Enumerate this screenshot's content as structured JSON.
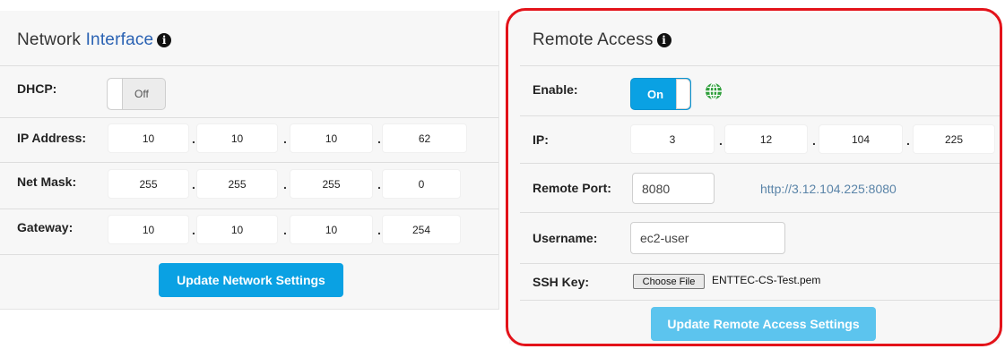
{
  "network": {
    "title_part1": "Network",
    "title_part2": "Interface",
    "dhcp_label": "DHCP:",
    "dhcp_state": "Off",
    "ip_label": "IP Address:",
    "ip": [
      "10",
      "10",
      "10",
      "62"
    ],
    "mask_label": "Net Mask:",
    "mask": [
      "255",
      "255",
      "255",
      "0"
    ],
    "gateway_label": "Gateway:",
    "gateway": [
      "10",
      "10",
      "10",
      "254"
    ],
    "update_button": "Update Network Settings"
  },
  "remote": {
    "title": "Remote Access",
    "enable_label": "Enable:",
    "enable_state": "On",
    "ip_label": "IP:",
    "ip": [
      "3",
      "12",
      "104",
      "225"
    ],
    "port_label": "Remote Port:",
    "port_value": "8080",
    "remote_url": "http://3.12.104.225:8080",
    "username_label": "Username:",
    "username_value": "ec2-user",
    "ssh_label": "SSH Key:",
    "choose_file": "Choose File",
    "ssh_file": "ENTTEC-CS-Test.pem",
    "update_button": "Update Remote Access Settings"
  },
  "info_glyph": "i",
  "separator": ".",
  "colors": {
    "accent_blue": "#0aa1e3",
    "disabled_blue": "#5cc4ee",
    "highlight_red": "#e3131a",
    "globe_green": "#2e9e3a"
  },
  "icons": [
    "info-icon",
    "globe-icon"
  ]
}
